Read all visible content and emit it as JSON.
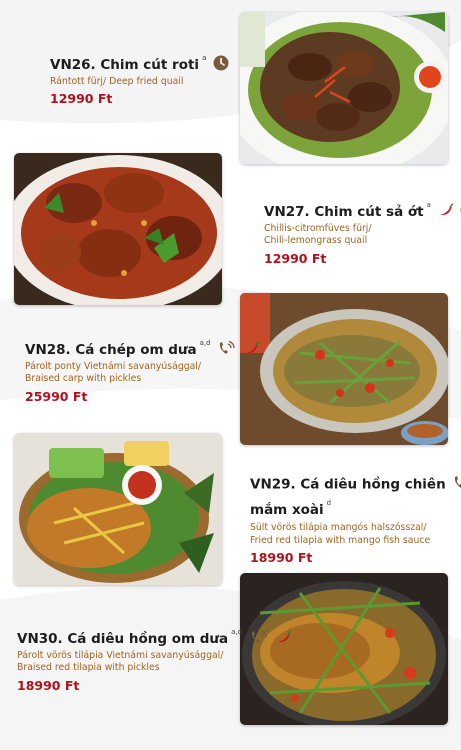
{
  "items": [
    {
      "code_name": "VN26. Chim cút roti",
      "allergens": "a",
      "desc_lines": [
        "Rántott fürj/ Deep fried quail"
      ],
      "price": "12990 Ft",
      "icons": [
        "clock-icon"
      ]
    },
    {
      "code_name": "VN27. Chim cút sả ớt",
      "allergens": "a",
      "desc_lines": [
        "Chillis-citromfüves fürj/",
        "Chili-lemongrass quail"
      ],
      "price": "12990 Ft",
      "icons": [
        "chili-icon",
        "clock-icon"
      ]
    },
    {
      "code_name": "VN28. Cá chép om dưa",
      "allergens": "a,d",
      "desc_lines": [
        "Párolt ponty Vietnámi savanyúsággal/",
        "Braised carp with pickles"
      ],
      "price": "25990 Ft",
      "icons": [
        "phone-icon",
        "chili-icon"
      ]
    },
    {
      "code_name_line1": "VN29. Cá diêu hồng chiên",
      "code_name_line2": "mắm xoài",
      "allergens": "d",
      "desc_lines": [
        "Sült vörös tilápia mangós halszósszal/",
        "Fried red tilapia with mango fish sauce"
      ],
      "price": "18990 Ft",
      "icons": [
        "phone-icon"
      ]
    },
    {
      "code_name": "VN30. Cá diêu hồng om dưa",
      "allergens": "a,d",
      "desc_lines": [
        "Párolt vörös tilápia Vietnámi savanyúsággal/",
        "Braised red tilapia with pickles"
      ],
      "price": "18990 Ft",
      "icons": [
        "phone-icon",
        "chili-icon"
      ]
    }
  ],
  "colors": {
    "title": "#1d1d1d",
    "desc": "#a06420",
    "price": "#b0121c",
    "icon_brown": "#7a5a3a",
    "chili_red": "#c8141c"
  }
}
